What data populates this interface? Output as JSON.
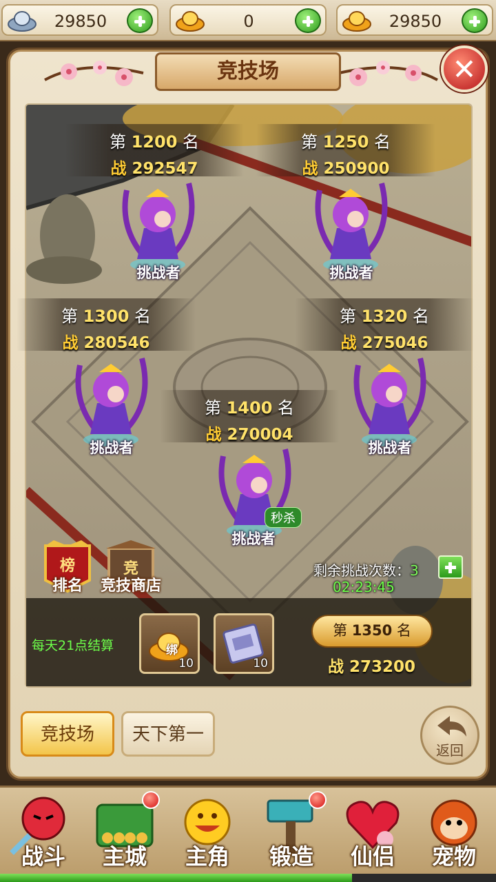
{
  "currency": [
    {
      "icon": "silver-ingot-icon",
      "value": "29850"
    },
    {
      "icon": "gold-ingot-icon",
      "value": "0"
    },
    {
      "icon": "bound-gold-ingot-icon",
      "value": "29850"
    }
  ],
  "panel": {
    "title": "竞技场"
  },
  "opponents": [
    {
      "rank_prefix": "第",
      "rank": "1200",
      "rank_suffix": "名",
      "power_mark": "战",
      "power": "292547",
      "label": "挑战者"
    },
    {
      "rank_prefix": "第",
      "rank": "1250",
      "rank_suffix": "名",
      "power_mark": "战",
      "power": "250900",
      "label": "挑战者"
    },
    {
      "rank_prefix": "第",
      "rank": "1300",
      "rank_suffix": "名",
      "power_mark": "战",
      "power": "280546",
      "label": "挑战者"
    },
    {
      "rank_prefix": "第",
      "rank": "1320",
      "rank_suffix": "名",
      "power_mark": "战",
      "power": "275046",
      "label": "挑战者"
    },
    {
      "rank_prefix": "第",
      "rank": "1400",
      "rank_suffix": "名",
      "power_mark": "战",
      "power": "270004",
      "label": "挑战者",
      "badge": "秒杀"
    }
  ],
  "side_buttons": {
    "ranking": {
      "label": "排名",
      "icon_text": "榜"
    },
    "shop": {
      "label": "竞技商店",
      "icon_text": "竞"
    }
  },
  "challenges": {
    "label": "剩余挑战次数：",
    "count": "3",
    "timer": "02:23:45"
  },
  "rewards": {
    "settle_text": "每天21点结算",
    "items": [
      {
        "icon": "gold-ingot-icon",
        "tag": "绑",
        "count": "10"
      },
      {
        "icon": "scroll-ticket-icon",
        "tag": "",
        "count": "10"
      }
    ]
  },
  "my_rank": {
    "prefix": "第",
    "rank": "1350",
    "suffix": "名",
    "power_mark": "战",
    "power": "273200"
  },
  "tabs": [
    {
      "label": "竞技场",
      "active": true
    },
    {
      "label": "天下第一",
      "active": false
    }
  ],
  "back_button": {
    "label": "返回"
  },
  "bottom_nav": [
    {
      "label": "战斗",
      "icon": "fighter-icon",
      "badge": false
    },
    {
      "label": "主城",
      "icon": "city-gate-icon",
      "badge": true
    },
    {
      "label": "主角",
      "icon": "hero-face-icon",
      "badge": false
    },
    {
      "label": "锻造",
      "icon": "hammer-icon",
      "badge": true
    },
    {
      "label": "仙侣",
      "icon": "heart-flower-icon",
      "badge": false
    },
    {
      "label": "宠物",
      "icon": "monkey-icon",
      "badge": false
    }
  ],
  "colors": {
    "accent_gold": "#ffe26a",
    "timer_green": "#6dff4a",
    "close_red": "#b5161b"
  },
  "experience_progress": 0.71
}
